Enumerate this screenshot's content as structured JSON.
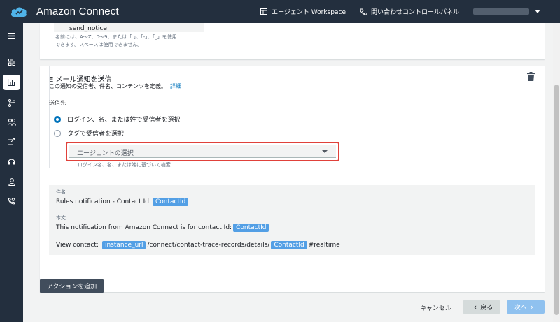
{
  "app": {
    "title": "Amazon Connect"
  },
  "topbar": {
    "workspace_label": "エージェント Workspace",
    "ccp_label": "問い合わせコントロールパネル"
  },
  "sidebar": {
    "icons": [
      "menu-icon",
      "dashboard-icon",
      "analytics-icon",
      "routing-icon",
      "users-icon",
      "channels-icon",
      "headset-icon",
      "agent-icon",
      "phone-settings-icon"
    ],
    "active_index": 2
  },
  "rule_name": {
    "value": "send_notice",
    "hint_line1": "名前には、A～Z、0～9、または「.」、「-」、「_」を使用",
    "hint_line2": "できます。スペースは使用できません。"
  },
  "email_action": {
    "title": "E メール通知を送信",
    "description": "この通知の受信者、件名、コンテンツを定義。",
    "details_link": "詳細",
    "recipient_label": "送信先",
    "options": [
      {
        "label": "ログイン、名、または姓で受信者を選択",
        "checked": true
      },
      {
        "label": "タグで受信者を選択",
        "checked": false
      }
    ],
    "select_placeholder": "エージェントの選択",
    "select_hint": "ログイン名、名、または姓に基づいて検索"
  },
  "message": {
    "subject_label": "件名",
    "subject_text": "Rules notification - Contact Id:",
    "subject_tag": "ContactId",
    "body_label": "本文",
    "body_line1_text": "This notification from Amazon Connect is for contact Id:",
    "body_line1_tag": "ContactId",
    "body_line2_prefix": "View contact:",
    "body_line2_tag1": "instance_url",
    "body_line2_middle": "/connect/contact-trace-records/details/",
    "body_line2_tag2": "ContactId",
    "body_line2_suffix": "#realtime"
  },
  "footer": {
    "add_action_label": "アクションを追加",
    "cancel_label": "キャンセル",
    "back_label": "戻る",
    "next_label": "次へ"
  },
  "colors": {
    "nav_bg": "#232f3e",
    "link": "#0073bb",
    "tag_bg": "#539fe5",
    "highlight_border": "#e0413a",
    "next_disabled": "#8fc1ef"
  }
}
